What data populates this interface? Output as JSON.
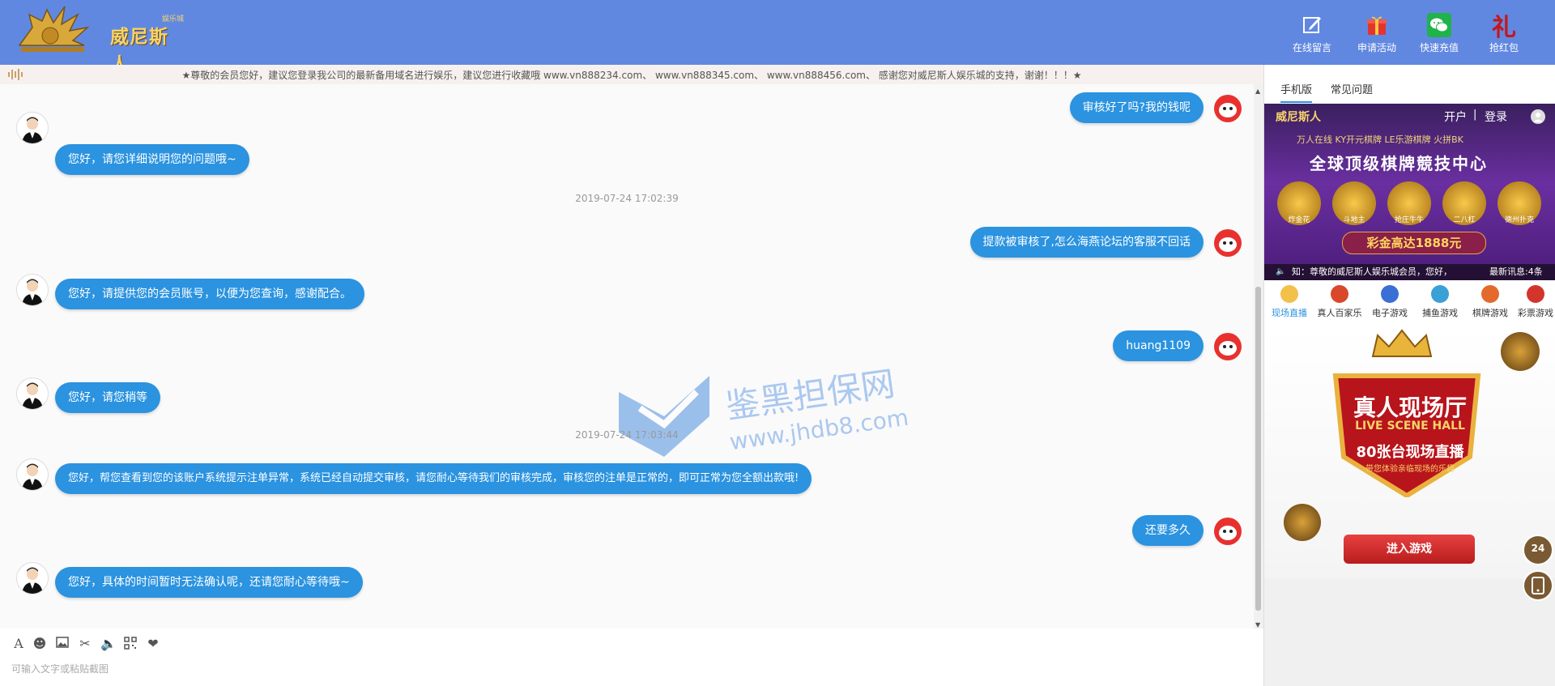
{
  "header": {
    "logo_text": "威尼斯人",
    "logo_sup": "娱乐城",
    "buttons": [
      {
        "label": "在线留言",
        "icon": "edit-icon"
      },
      {
        "label": "申请活动",
        "icon": "gift-icon"
      },
      {
        "label": "快速充值",
        "icon": "wechat-icon"
      },
      {
        "label": "抢红包",
        "icon": "red-packet-icon"
      }
    ],
    "bg_color": "#6188e1"
  },
  "notice": {
    "text": "★尊敬的会员您好，建议您登录我公司的最新备用域名进行娱乐，建议您进行收藏哦 www.vn888234.com、 www.vn888345.com、 www.vn888456.com、 感谢您对威尼斯人娱乐城的支持，谢谢！！！★"
  },
  "chat": {
    "messages": [
      {
        "from": "user",
        "text": "审核好了吗?我的钱呢"
      },
      {
        "from": "agent",
        "text": "您好，请您详细说明您的问题哦~"
      },
      {
        "from": "time",
        "text": "2019-07-24 17:02:39"
      },
      {
        "from": "user",
        "text": "提款被审核了,怎么海燕论坛的客服不回话"
      },
      {
        "from": "agent",
        "text": "您好，请提供您的会员账号，以便为您查询，感谢配合。"
      },
      {
        "from": "user",
        "text": "huang1109"
      },
      {
        "from": "agent",
        "text": "您好，请您稍等"
      },
      {
        "from": "time",
        "text": "2019-07-24 17:03:44"
      },
      {
        "from": "agent",
        "text": "您好，帮您查看到您的该账户系统提示注单异常，系统已经自动提交审核，请您耐心等待我们的审核完成，审核您的注单是正常的，即可正常为您全额出款哦!"
      },
      {
        "from": "user",
        "text": "还要多久"
      },
      {
        "from": "agent",
        "text": "您好，具体的时间暂时无法确认呢，还请您耐心等待哦~"
      }
    ],
    "bubble_color": "#2b93e0",
    "watermark": {
      "cn": "鉴黑担保网",
      "url": "www.jhdb8.com"
    }
  },
  "toolbar": {
    "icons": [
      "font-icon",
      "emoji-icon",
      "image-icon",
      "scissors-icon",
      "voice-icon",
      "qrcode-icon",
      "heart-icon"
    ]
  },
  "input": {
    "placeholder": "可输入文字或粘贴截图",
    "value": ""
  },
  "right_panel": {
    "tabs": [
      {
        "label": "手机版",
        "active": true
      },
      {
        "label": "常见问题",
        "active": false
      }
    ],
    "banner": {
      "logo": "威尼斯人",
      "open_account": "开户",
      "divider": "|",
      "login": "登录",
      "slogan_line": "万人在线  KY开元棋牌  LE乐游棋牌  火拼BK",
      "title": "全球顶级棋牌競技中心",
      "prize": "彩金高达1888元",
      "ticker": "知：尊敬的威尼斯人娱乐城会员，您好，",
      "ticker_tail": "最新讯息:4条",
      "game_labels": [
        "炸金花",
        "斗地主",
        "抢庄牛牛",
        "二八杠",
        "德州扑克"
      ]
    },
    "game_tabs": [
      {
        "label": "现场直播",
        "active": true
      },
      {
        "label": "真人百家乐",
        "active": false
      },
      {
        "label": "电子游戏",
        "active": false
      },
      {
        "label": "捕鱼游戏",
        "active": false
      },
      {
        "label": "棋牌游戏",
        "active": false
      },
      {
        "label": "彩票游戏",
        "active": false
      }
    ],
    "hall": {
      "title_cn": "真人现场厅",
      "title_en": "LIVE SCENE HALL",
      "subtitle": "80张台现场直播",
      "desc": "带您体验亲临现场的乐趣",
      "enter_button": "进入游戏"
    },
    "float_badge": "24"
  }
}
